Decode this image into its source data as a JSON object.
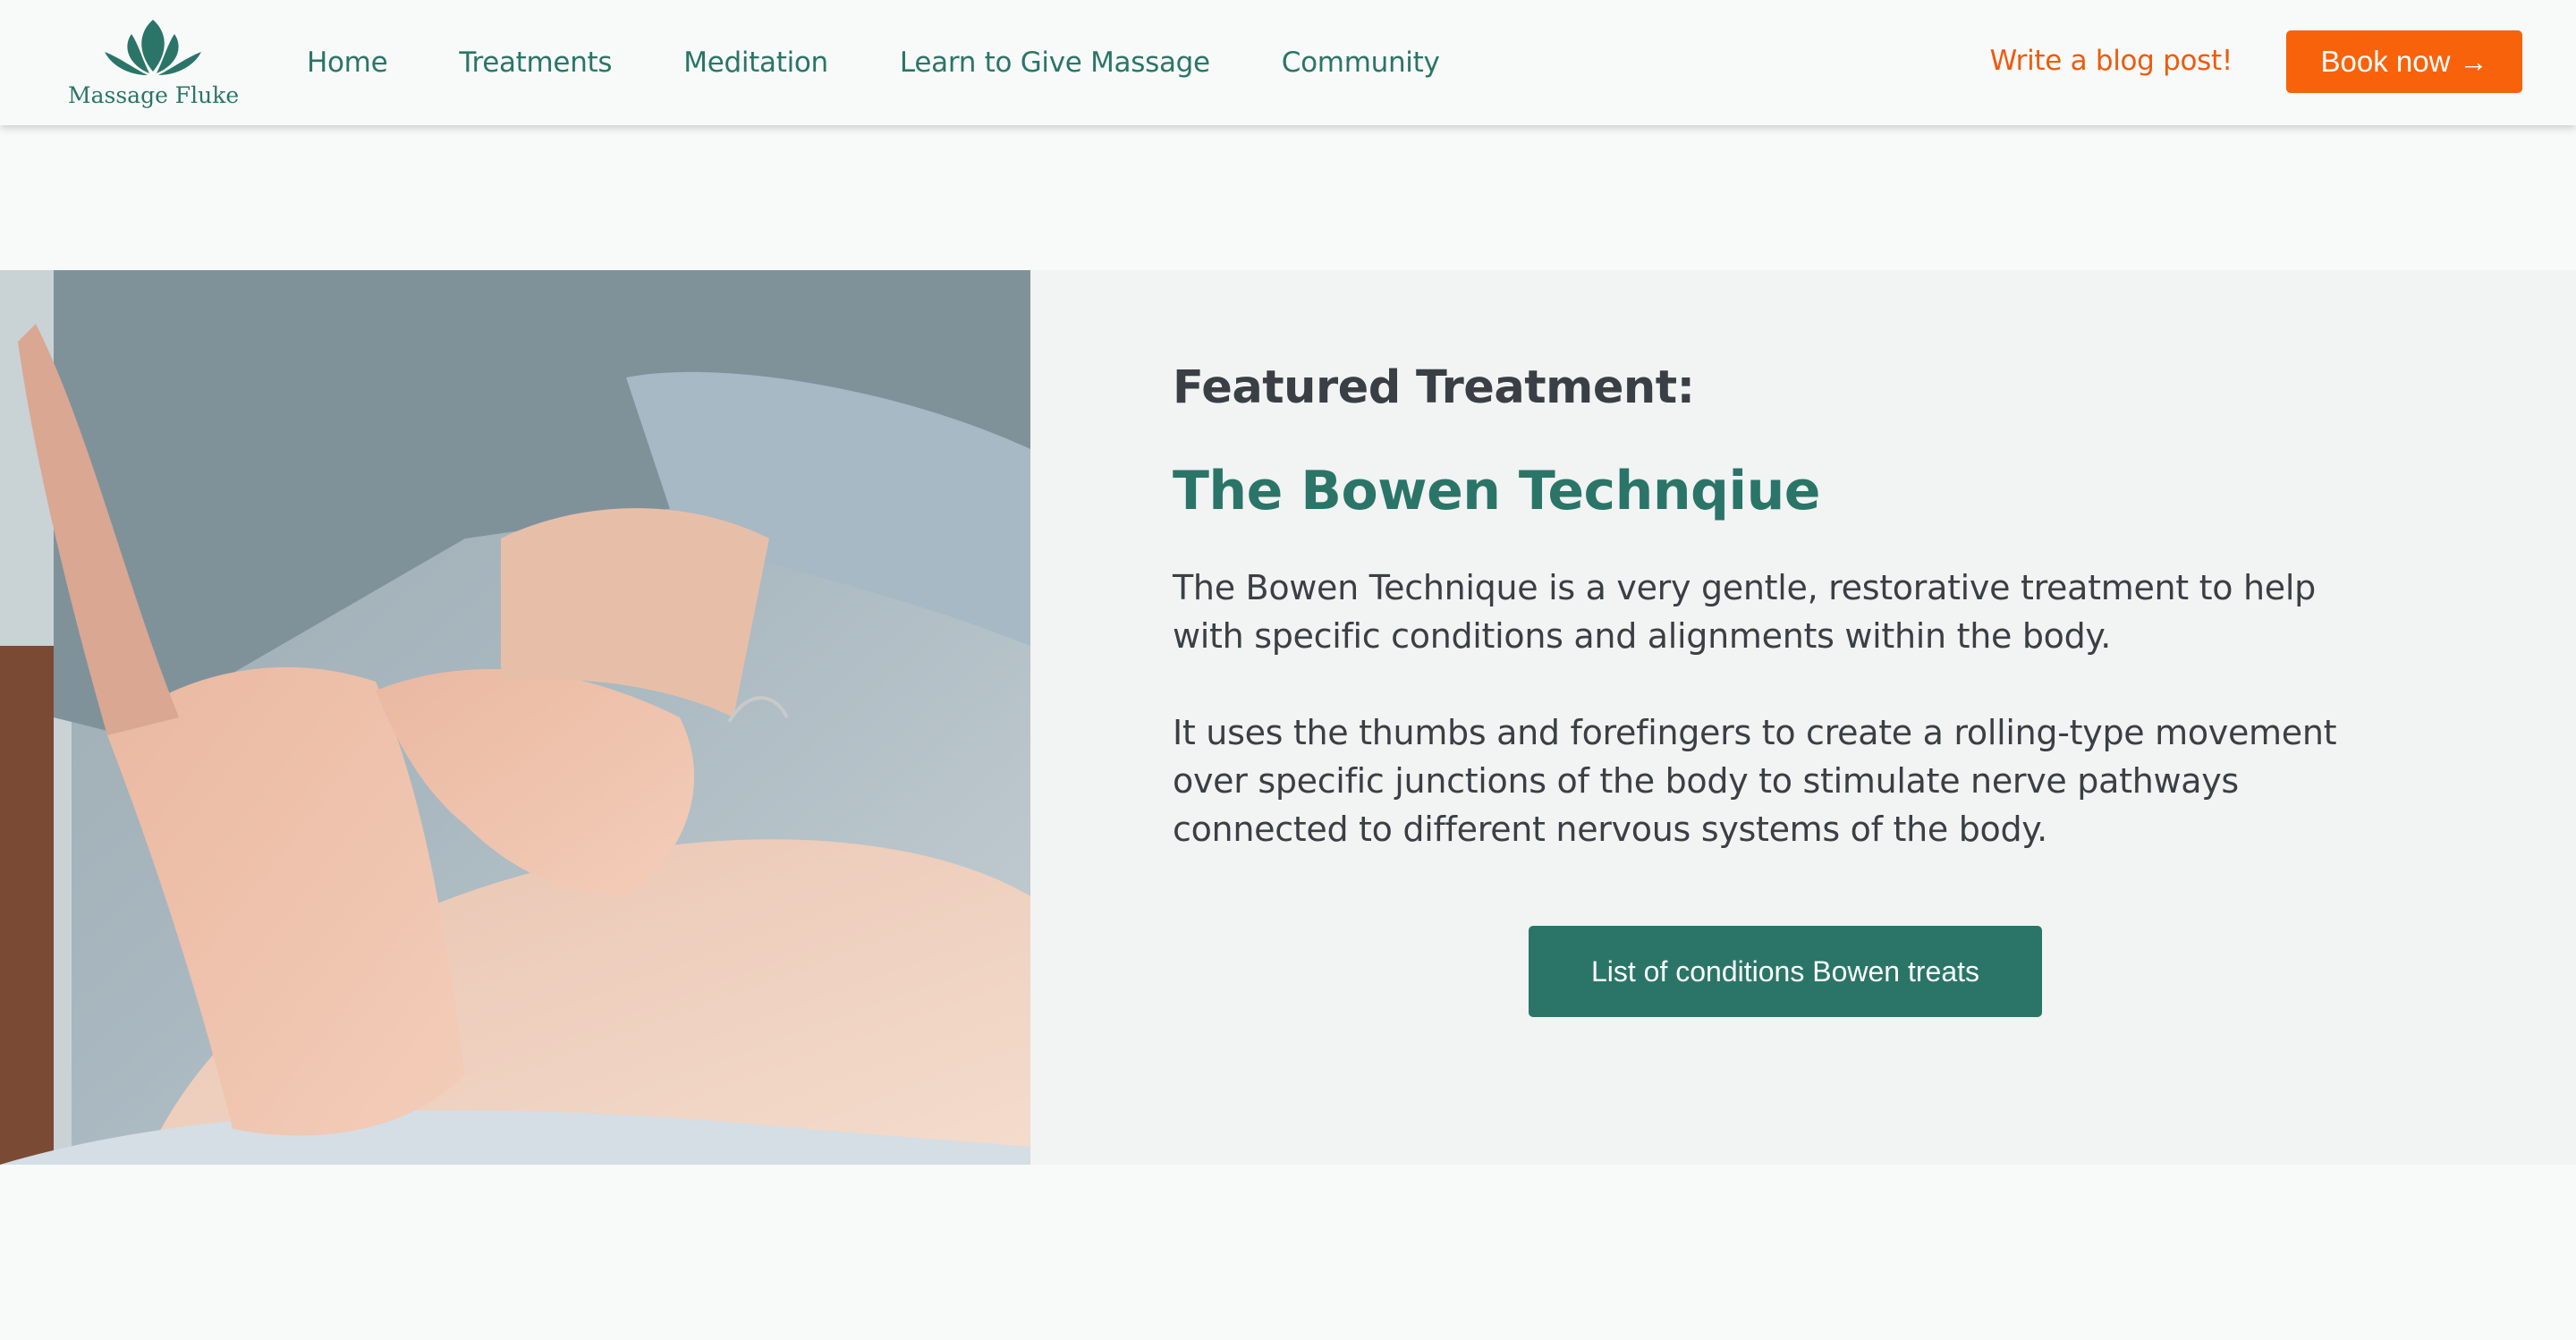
{
  "brand": {
    "name": "Massage Fluke",
    "color": "#2a7568"
  },
  "nav": {
    "items": [
      {
        "label": "Home"
      },
      {
        "label": "Treatments"
      },
      {
        "label": "Meditation"
      },
      {
        "label": "Learn to Give Massage"
      },
      {
        "label": "Community"
      }
    ]
  },
  "header_actions": {
    "blog_label": "Write a blog post!",
    "book_label": "Book now",
    "book_arrow": "→",
    "accent_color": "#f8620a"
  },
  "feature": {
    "label": "Featured Treatment:",
    "title": "The Bowen Technqiue",
    "paragraphs": [
      "The Bowen Technique is a very gentle, restorative treatment to help with specific conditions and alignments within the body.",
      "It uses the thumbs and forefingers to create a rolling-type movement over specific junctions of the body to stimulate nerve pathways connected to different nervous systems of the body."
    ],
    "button_label": "List of conditions Bowen treats",
    "image_icon": "massage-photo"
  }
}
